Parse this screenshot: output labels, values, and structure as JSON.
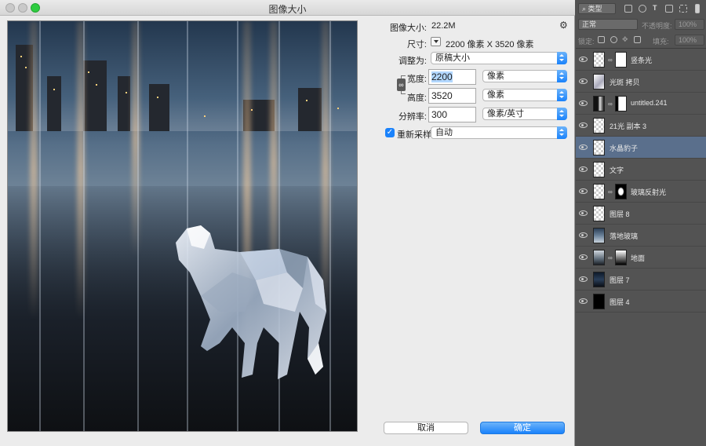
{
  "dialog": {
    "title": "图像大小",
    "image_size_label": "图像大小:",
    "image_size_value": "22.2M",
    "dimensions_label": "尺寸:",
    "dimensions_value": "2200 像素  X  3520 像素",
    "fit_to_label": "调整为:",
    "fit_to_value": "原稿大小",
    "width_label": "宽度:",
    "width_value": "2200",
    "width_unit": "像素",
    "height_label": "高度:",
    "height_value": "3520",
    "height_unit": "像素",
    "resolution_label": "分辨率:",
    "resolution_value": "300",
    "resolution_unit": "像素/英寸",
    "resample_label": "重新采样:",
    "resample_checked": true,
    "resample_value": "自动",
    "cancel_label": "取消",
    "ok_label": "确定",
    "gear_icon": "gear-icon",
    "link_icon": "chain-link-icon",
    "accent_color": "#1a82fb"
  },
  "layers_panel": {
    "filter_kind": "类型",
    "blend_mode": "正常",
    "opacity_label": "不透明度:",
    "opacity_value": "100%",
    "lock_label": "锁定:",
    "fill_label": "填充:",
    "fill_value": "100%",
    "layers": [
      {
        "name": "竖条光",
        "thumb": "transparent",
        "mask": "white"
      },
      {
        "name": "光斑 拷贝",
        "thumb": "image-light"
      },
      {
        "name": "untitled.241",
        "thumb": "dark",
        "mask": "white-black"
      },
      {
        "name": "21光 副本 3",
        "thumb": "transparent"
      },
      {
        "name": "水晶豹子",
        "thumb": "transparent",
        "selected": true
      },
      {
        "name": "文字",
        "thumb": "transparent"
      },
      {
        "name": "玻璃反射光",
        "thumb": "transparent",
        "mask": "black-white-shape"
      },
      {
        "name": "图层 8",
        "thumb": "transparent"
      },
      {
        "name": "落地玻璃",
        "thumb": "image-city"
      },
      {
        "name": "地面",
        "thumb": "image-floor",
        "mask": "gradient"
      },
      {
        "name": "图层 7",
        "thumb": "image-night"
      },
      {
        "name": "图层 4",
        "thumb": "black"
      }
    ],
    "selected_color": "#5a6f8c"
  }
}
